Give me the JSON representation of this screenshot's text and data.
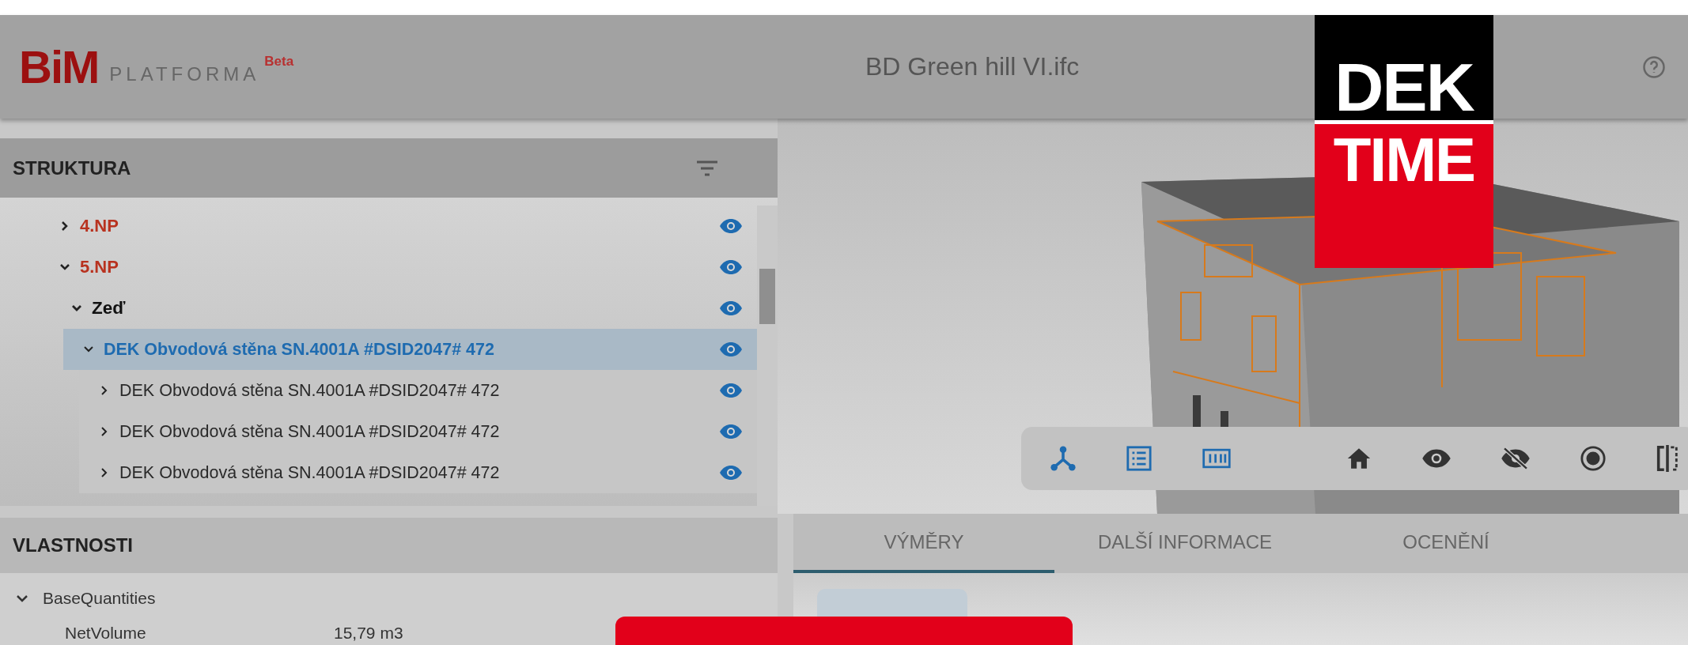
{
  "header": {
    "logo": "BiM",
    "product": "PLATFORMA",
    "badge": "Beta",
    "file_title": "BD Green hill VI.ifc"
  },
  "structure_panel": {
    "title": "STRUKTURA",
    "tree": [
      {
        "label": "4.NP",
        "kind": "storey",
        "expanded": false,
        "selected": false
      },
      {
        "label": "5.NP",
        "kind": "storey",
        "expanded": true,
        "selected": false,
        "children": [
          {
            "label": "Zeď",
            "kind": "group",
            "expanded": true,
            "selected": false,
            "children": [
              {
                "label": "DEK Obvodová stěna SN.4001A #DSID2047# 472",
                "kind": "element",
                "expanded": true,
                "selected": true,
                "children": [
                  {
                    "label": "DEK Obvodová stěna SN.4001A #DSID2047# 472",
                    "kind": "element",
                    "expanded": false,
                    "selected": false
                  },
                  {
                    "label": "DEK Obvodová stěna SN.4001A #DSID2047# 472",
                    "kind": "element",
                    "expanded": false,
                    "selected": false
                  },
                  {
                    "label": "DEK Obvodová stěna SN.4001A #DSID2047# 472",
                    "kind": "element",
                    "expanded": false,
                    "selected": false
                  }
                ]
              }
            ]
          }
        ]
      }
    ]
  },
  "viewer": {
    "overlay_logo": {
      "top": "DEK",
      "bottom": "TIME"
    }
  },
  "properties_panel": {
    "title": "VLASTNOSTI",
    "groups": [
      {
        "name": "BaseQuantities",
        "expanded": true,
        "rows": [
          {
            "name": "NetVolume",
            "value": "15,79 m3"
          }
        ]
      }
    ]
  },
  "tabs": [
    {
      "label": "VÝMĚRY",
      "selected": true
    },
    {
      "label": "DALŠÍ INFORMACE",
      "selected": false
    },
    {
      "label": "OCENĚNÍ",
      "selected": false
    }
  ]
}
